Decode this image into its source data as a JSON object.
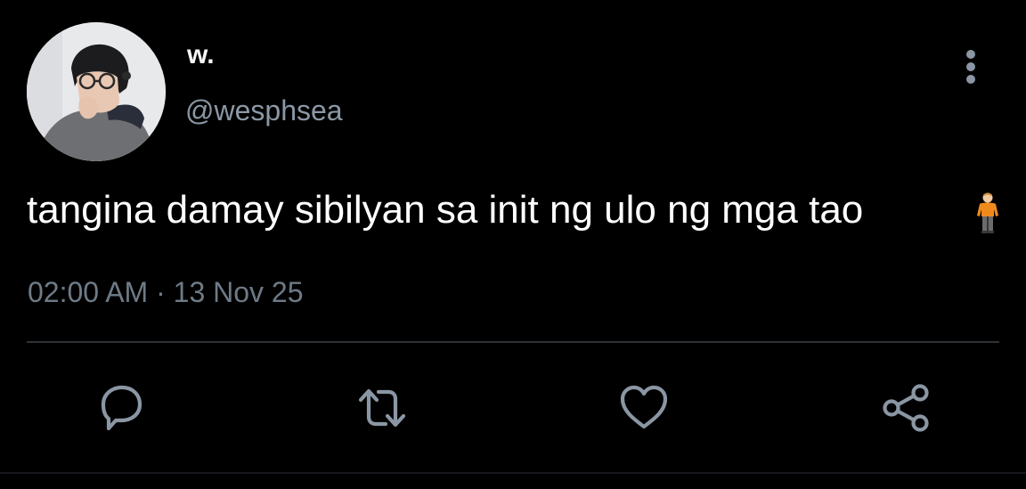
{
  "tweet": {
    "author": {
      "display_name": "w.",
      "handle": "@wesphsea"
    },
    "text": "tangina damay sibilyan sa init ng ulo ng mga tao",
    "emoji": "person-standing-orange",
    "timestamp": "02:00 AM · 13 Nov 25"
  },
  "icons": {
    "more": "more-vertical-icon",
    "reply": "reply-icon",
    "retweet": "retweet-icon",
    "like": "heart-icon",
    "share": "share-icon"
  },
  "colors": {
    "background": "#000000",
    "text": "#ffffff",
    "secondary": "#8b98a5",
    "icon": "#8a96a3",
    "divider": "#2f3336"
  }
}
